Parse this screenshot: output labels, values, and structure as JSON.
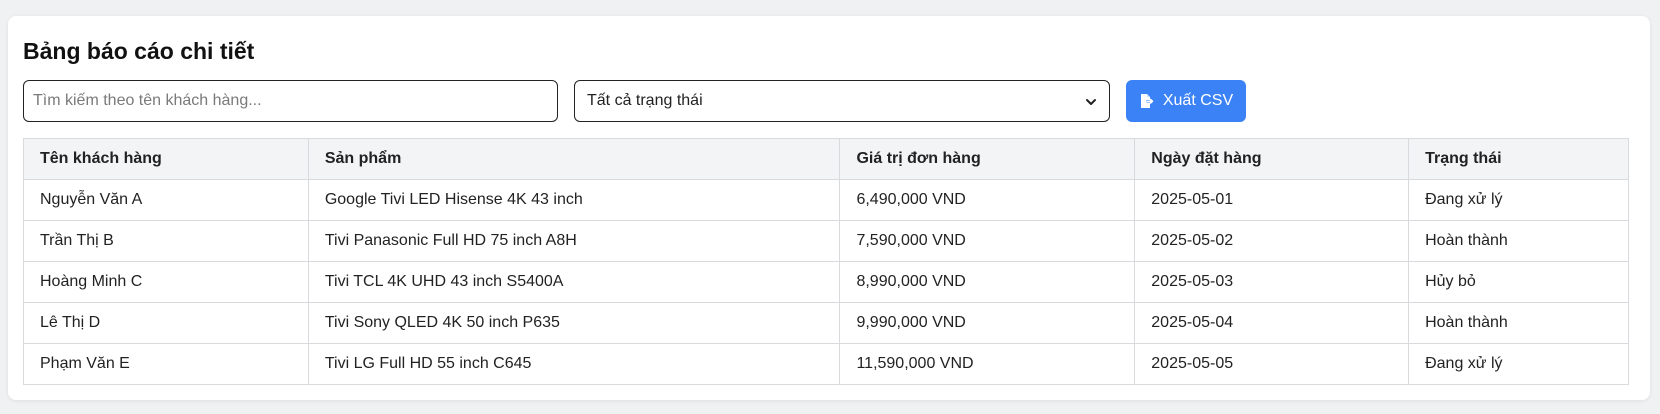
{
  "report": {
    "title": "Bảng báo cáo chi tiết",
    "search": {
      "placeholder": "Tìm kiếm theo tên khách hàng...",
      "value": ""
    },
    "status_filter": {
      "selected": "Tất cả trạng thái"
    },
    "export_button": {
      "label": "Xuất CSV",
      "icon": "file-export-icon"
    },
    "colors": {
      "accent": "#3b82f6",
      "header_bg": "#f3f4f6",
      "border": "#d8dadd"
    },
    "table": {
      "headers": [
        "Tên khách hàng",
        "Sản phẩm",
        "Giá trị đơn hàng",
        "Ngày đặt hàng",
        "Trạng thái"
      ],
      "rows": [
        [
          "Nguyễn Văn A",
          "Google Tivi LED Hisense 4K 43 inch",
          "6,490,000 VND",
          "2025-05-01",
          "Đang xử lý"
        ],
        [
          "Trần Thị B",
          "Tivi Panasonic Full HD 75 inch A8H",
          "7,590,000 VND",
          "2025-05-02",
          "Hoàn thành"
        ],
        [
          "Hoàng Minh C",
          "Tivi TCL 4K UHD 43 inch S5400A",
          "8,990,000 VND",
          "2025-05-03",
          "Hủy bỏ"
        ],
        [
          "Lê Thị D",
          "Tivi Sony QLED 4K 50 inch P635",
          "9,990,000 VND",
          "2025-05-04",
          "Hoàn thành"
        ],
        [
          "Phạm Văn E",
          "Tivi LG Full HD 55 inch C645",
          "11,590,000 VND",
          "2025-05-05",
          "Đang xử lý"
        ]
      ]
    }
  }
}
